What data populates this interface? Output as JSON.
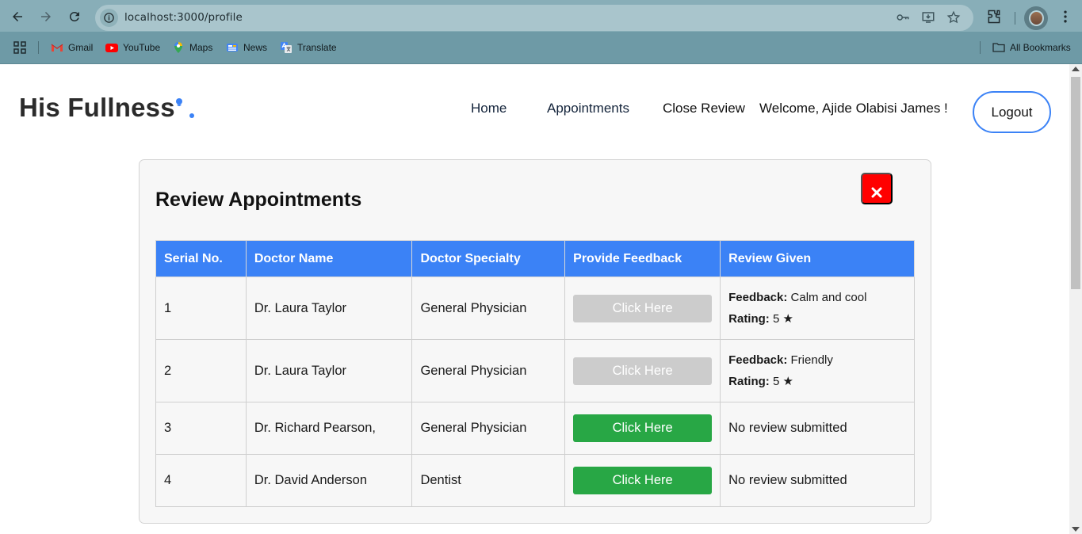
{
  "browser": {
    "url": "localhost:3000/profile",
    "bookmarks": [
      {
        "label": "Gmail",
        "icon": "gmail-icon"
      },
      {
        "label": "YouTube",
        "icon": "youtube-icon"
      },
      {
        "label": "Maps",
        "icon": "maps-icon"
      },
      {
        "label": "News",
        "icon": "news-icon"
      },
      {
        "label": "Translate",
        "icon": "translate-icon"
      }
    ],
    "all_bookmarks_label": "All Bookmarks"
  },
  "header": {
    "brand": "His Fullness",
    "nav": [
      {
        "label": "Home"
      },
      {
        "label": "Appointments"
      },
      {
        "label": "Close Review"
      }
    ],
    "welcome": "Welcome, Ajide Olabisi James !",
    "logout_label": "Logout"
  },
  "panel": {
    "title": "Review Appointments",
    "close_icon": "close-icon",
    "columns": [
      "Serial No.",
      "Doctor Name",
      "Doctor Specialty",
      "Provide Feedback",
      "Review Given"
    ],
    "feedback_label": "Feedback:",
    "rating_label": "Rating:",
    "rows": [
      {
        "serial": "1",
        "doctor": "Dr. Laura Taylor",
        "specialty": "General Physician",
        "button": "Click Here",
        "button_enabled": false,
        "feedback": "Calm and cool",
        "rating": "5 ★",
        "review_text": ""
      },
      {
        "serial": "2",
        "doctor": "Dr. Laura Taylor",
        "specialty": "General Physician",
        "button": "Click Here",
        "button_enabled": false,
        "feedback": "Friendly",
        "rating": "5 ★",
        "review_text": ""
      },
      {
        "serial": "3",
        "doctor": "Dr. Richard Pearson,",
        "specialty": "General Physician",
        "button": "Click Here",
        "button_enabled": true,
        "feedback": "",
        "rating": "",
        "review_text": "No review submitted"
      },
      {
        "serial": "4",
        "doctor": "Dr. David Anderson",
        "specialty": "Dentist",
        "button": "Click Here",
        "button_enabled": true,
        "feedback": "",
        "rating": "",
        "review_text": "No review submitted"
      }
    ]
  },
  "colors": {
    "accent": "#3b82f6",
    "close": "#ff0000",
    "enabled_button": "#28a745",
    "disabled_button": "#cccccc"
  }
}
